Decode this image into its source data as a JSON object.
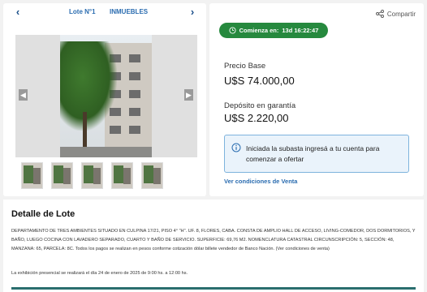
{
  "lot_nav": {
    "lot_label": "Lote N°1",
    "category": "INMUEBLES"
  },
  "share": {
    "label": "Compartir"
  },
  "timer": {
    "label": "Comienza en:",
    "value": "13d 16:22:47"
  },
  "pricing": {
    "base_label": "Precio Base",
    "base_value": "U$S 74.000,00",
    "deposit_label": "Depósito en garantía",
    "deposit_value": "U$S 2.220,00"
  },
  "notice": {
    "text": "Iniciada la subasta ingresá a tu cuenta para comenzar a ofertar"
  },
  "conditions_link": "Ver condiciones de Venta",
  "detail": {
    "title": "Detalle de Lote",
    "description": "DEPARTAMENTO DE TRES AMBIENTES SITUADO EN CULPINA 17/21, PISO 4° \"H\". UF. 8, FLORES, CABA. CONSTA DE AMPLIO HALL DE ACCESO, LIVING-COMEDOR, DOS DORMITORIOS, Y BAÑO, LUEGO COCINA CON LAVADERO SEPARADO, CUARTO Y BAÑO DE SERVICIO. SUPERFICIE: 69,76 M2. NOMENCLATURA CATASTRAL CIRCUNSCRIPCIÓN: 5, SECCIÓN: 48, MANZANA: 65, PARCELA: 8C. Todos los pagos se realizan en pesos conforme cotización dólar billete vendedor de Banco Nación. (Ver condiciones de venta)",
    "exhibition": "La exhibición presencial se realizará el día 24 de enero de 2025 de 9:00 hs. a 12:00 hs."
  },
  "colors": {
    "accent_blue": "#2a6cb0",
    "timer_green": "#26893e",
    "notice_bg": "#eaf3fb"
  }
}
